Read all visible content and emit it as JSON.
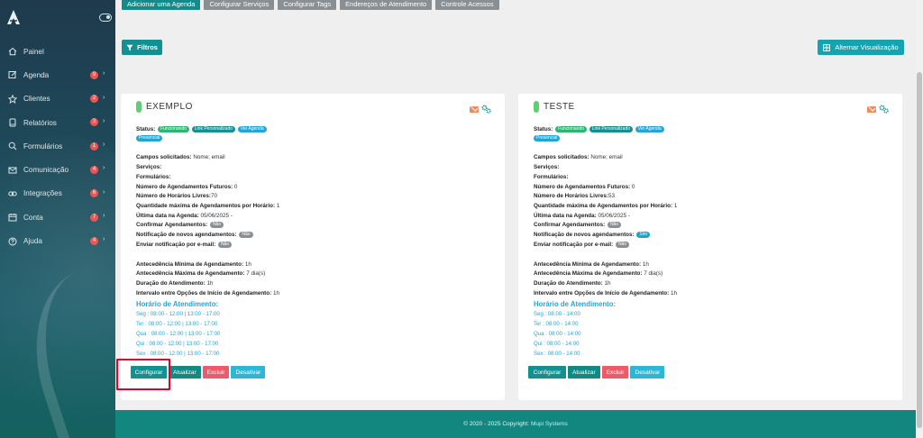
{
  "sidebar": {
    "items": [
      {
        "label": "Painel",
        "icon": "home-icon",
        "badge": null
      },
      {
        "label": "Agenda",
        "icon": "edit-icon",
        "badge": "9"
      },
      {
        "label": "Clientes",
        "icon": "star-icon",
        "badge": "2"
      },
      {
        "label": "Relatórios",
        "icon": "tablet-icon",
        "badge": "3"
      },
      {
        "label": "Formulários",
        "icon": "search-icon",
        "badge": "1"
      },
      {
        "label": "Comunicação",
        "icon": "mail-icon",
        "badge": "4"
      },
      {
        "label": "Integrações",
        "icon": "link-icon",
        "badge": "6"
      },
      {
        "label": "Conta",
        "icon": "calendar-icon",
        "badge": "7"
      },
      {
        "label": "Ajuda",
        "icon": "question-icon",
        "badge": "4"
      }
    ]
  },
  "tabs": [
    {
      "label": "Adicionar uma Agenda",
      "active": true
    },
    {
      "label": "Configurar Serviços",
      "active": false
    },
    {
      "label": "Configurar Tags",
      "active": false
    },
    {
      "label": "Endereços de Atendimento",
      "active": false
    },
    {
      "label": "Controle Acessos",
      "active": false
    }
  ],
  "toolbar": {
    "filter_label": "Filtros",
    "view_label": "Alternar Visualização"
  },
  "labels": {
    "status": "Status:",
    "campos": "Campos solicitados:",
    "servicos": "Serviços:",
    "formularios": "Formulários:",
    "futuros": "Número de Agendamentos Futuros:",
    "livres": "Número de Horários Livres:",
    "qtd_max": "Quantidade máxima de Agendamentos por Horário:",
    "ultima": "Última data na Agenda:",
    "confirmar": "Confirmar Agendamentos:",
    "notif_novos": "Notificação de novos agendamentos:",
    "notif_email": "Enviar notificação por e-mail:",
    "antec_min": "Antecedência Mínima de Agendamento:",
    "antec_max": "Antecedência Máxima de Agendamento:",
    "duracao": "Duração do Atendimento:",
    "intervalo": "Intervalo entre Opções de Início de Agendamento:",
    "horario_title": "Horário de Atendimento:"
  },
  "cards": [
    {
      "title": "EXEMPLO",
      "status_badges": [
        "Funcionando",
        "Link Personalizado",
        "Ver Agenda"
      ],
      "mode_badge": "Presencial",
      "campos": " Nome; email",
      "futuros": " 0",
      "livres": "70",
      "qtd_max": " 1",
      "ultima": " 05/06/2025 -",
      "confirmar": "Não",
      "notif_novos": "Não",
      "notif_email": "Não",
      "antec_min": " 1h",
      "antec_max": " 7 dia(s)",
      "duracao": " 1h",
      "intervalo": " 1h",
      "schedule": [
        "Seg : 08:00 - 12:00 | 13:00 - 17:00",
        "Ter : 08:00 - 12:00 | 13:00 - 17:00",
        "Qua : 08:00 - 12:00 | 13:00 - 17:00",
        "Qui : 08:00 - 12:00 | 13:00 - 17:00",
        "Sex : 08:00 - 12:00 | 13:00 - 17:00"
      ],
      "actions": {
        "configure": "Configurar",
        "update": "Atualizar",
        "delete": "Excluir",
        "deactivate": "Desativar"
      }
    },
    {
      "title": "TESTE",
      "status_badges": [
        "Funcionando",
        "Link Personalizado",
        "Ver Agenda"
      ],
      "mode_badge": "Presencial",
      "campos": " Nome; email",
      "futuros": " 0",
      "livres": "53",
      "qtd_max": " 1",
      "ultima": " 05/06/2025 -",
      "confirmar": "Não",
      "notif_novos": "Sim",
      "notif_email": "Não",
      "antec_min": " 1h",
      "antec_max": " 7 dia(s)",
      "duracao": " 1h",
      "intervalo": " 1h",
      "schedule": [
        "Seg : 08:00 - 14:00",
        "Ter : 08:00 - 14:00",
        "Qua : 08:00 - 14:00",
        "Qui : 08:00 - 14:00",
        "Sex : 08:00 - 14:00"
      ],
      "actions": {
        "configure": "Configurar",
        "update": "Atualizar",
        "delete": "Excluir",
        "deactivate": "Desativar"
      }
    }
  ],
  "footer": {
    "text": "© 2020 - 2025 Copyright:",
    "brand": "Mupi Systems"
  },
  "colors": {
    "primary": "#139090",
    "info": "#23a5d9",
    "danger": "#ef5a6a",
    "highlight": "#e4002b"
  }
}
